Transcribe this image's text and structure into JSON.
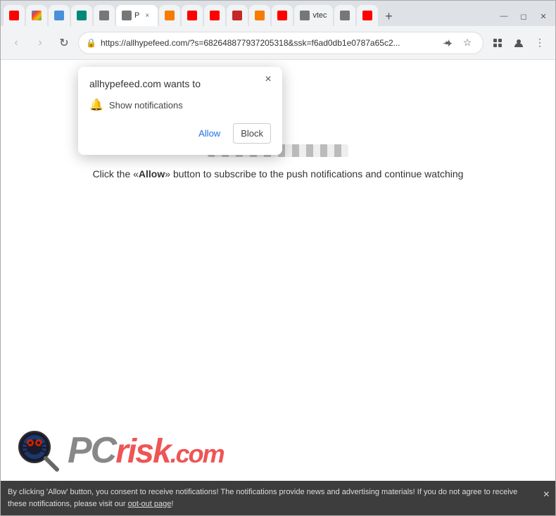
{
  "browser": {
    "tabs": [
      {
        "label": "",
        "favicon_class": "fav-yt",
        "active": false
      },
      {
        "label": "G",
        "favicon_class": "fav-g",
        "active": false
      },
      {
        "label": "",
        "favicon_class": "fav-blue",
        "active": false
      },
      {
        "label": "",
        "favicon_class": "fav-teal",
        "active": false
      },
      {
        "label": "",
        "favicon_class": "fav-gray",
        "active": false
      },
      {
        "label": "P ×",
        "favicon_class": "fav-gray",
        "active": true
      },
      {
        "label": "",
        "favicon_class": "fav-orange",
        "active": false
      },
      {
        "label": "",
        "favicon_class": "fav-yt",
        "active": false
      },
      {
        "label": "",
        "favicon_class": "fav-yt",
        "active": false
      },
      {
        "label": "",
        "favicon_class": "fav-red",
        "active": false
      },
      {
        "label": "",
        "favicon_class": "fav-orange",
        "active": false
      },
      {
        "label": "",
        "favicon_class": "fav-yt",
        "active": false
      },
      {
        "label": "vtec",
        "favicon_class": "fav-gray",
        "active": false
      },
      {
        "label": "",
        "favicon_class": "fav-gray",
        "active": false
      },
      {
        "label": "",
        "favicon_class": "fav-yt",
        "active": false
      }
    ],
    "url": "https://allhypefeed.com/?s=682648877937205318&ssk=f6ad0db1e0787a65c2...",
    "new_tab_icon": "+",
    "back_icon": "‹",
    "forward_icon": "›",
    "reload_icon": "↻",
    "lock_icon": "🔒"
  },
  "popup": {
    "title": "allhypefeed.com wants to",
    "permission_text": "Show notifications",
    "allow_label": "Allow",
    "block_label": "Block",
    "close_icon": "×"
  },
  "page": {
    "message": "Click the «Allow» button to subscribe to the push notifications and continue watching",
    "progress_label": "loading bar"
  },
  "consent_bar": {
    "text_before_link": "By clicking 'Allow' button, you consent to receive notifications! The notifications provide news and advertising materials! If you do not agree to receive these notifications, please visit our ",
    "link_text": "opt-out page",
    "text_after_link": "!",
    "close_icon": "×"
  },
  "pcrisk": {
    "logo_text": "PCrisk.com"
  }
}
